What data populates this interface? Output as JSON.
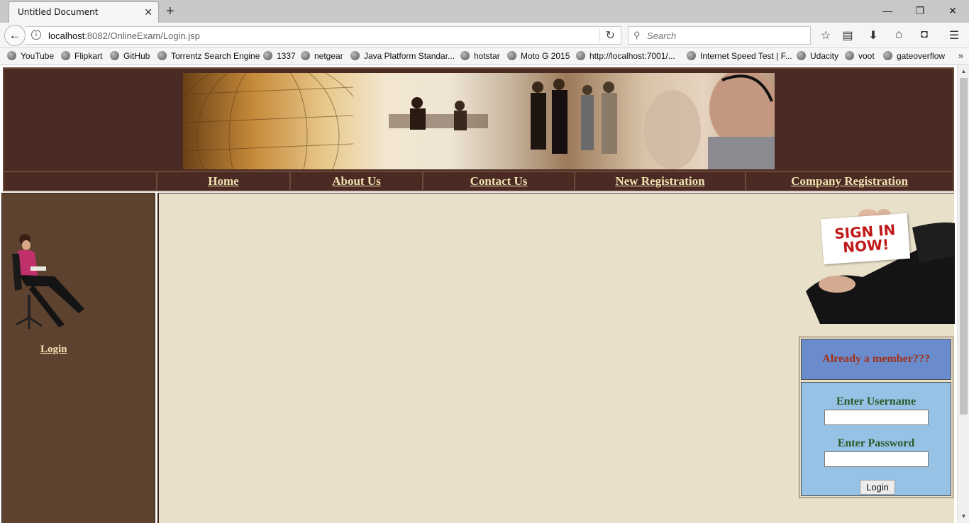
{
  "browser": {
    "tab_title": "Untitled Document",
    "url_host": "localhost",
    "url_rest": ":8082/OnlineExam/Login.jsp",
    "search_placeholder": "Search"
  },
  "bookmarks": [
    "YouTube",
    "Flipkart",
    "GitHub",
    "Torrentz Search Engine",
    "1337",
    "netgear",
    "Java Platform Standar...",
    "hotstar",
    "Moto G 2015",
    "http://localhost:7001/...",
    "Internet Speed Test | F...",
    "Udacity",
    "voot",
    "gateoverflow"
  ],
  "nav": {
    "home": "Home",
    "about": "About Us",
    "contact": "Contact Us",
    "new_registration": "New Registration",
    "company_registration": "Company Registration"
  },
  "sidebar": {
    "login_link": "Login"
  },
  "signin_banner": {
    "line1": "SIGN IN",
    "line2": "NOW!"
  },
  "login_form": {
    "heading": "Already a member???",
    "username_label": "Enter Username",
    "username_value": "",
    "password_label": "Enter Password",
    "password_value": "",
    "submit_label": "Login"
  },
  "colors": {
    "header_bg": "#4a2a22",
    "sidebar_bg": "#5e4230",
    "main_bg": "#e8e0c8",
    "nav_link": "#f2e2b2",
    "panel_head_bg": "#6b8ccc",
    "panel_body_bg": "#96c2e6",
    "heading_text": "#a03018",
    "label_text": "#2a5a2a"
  }
}
